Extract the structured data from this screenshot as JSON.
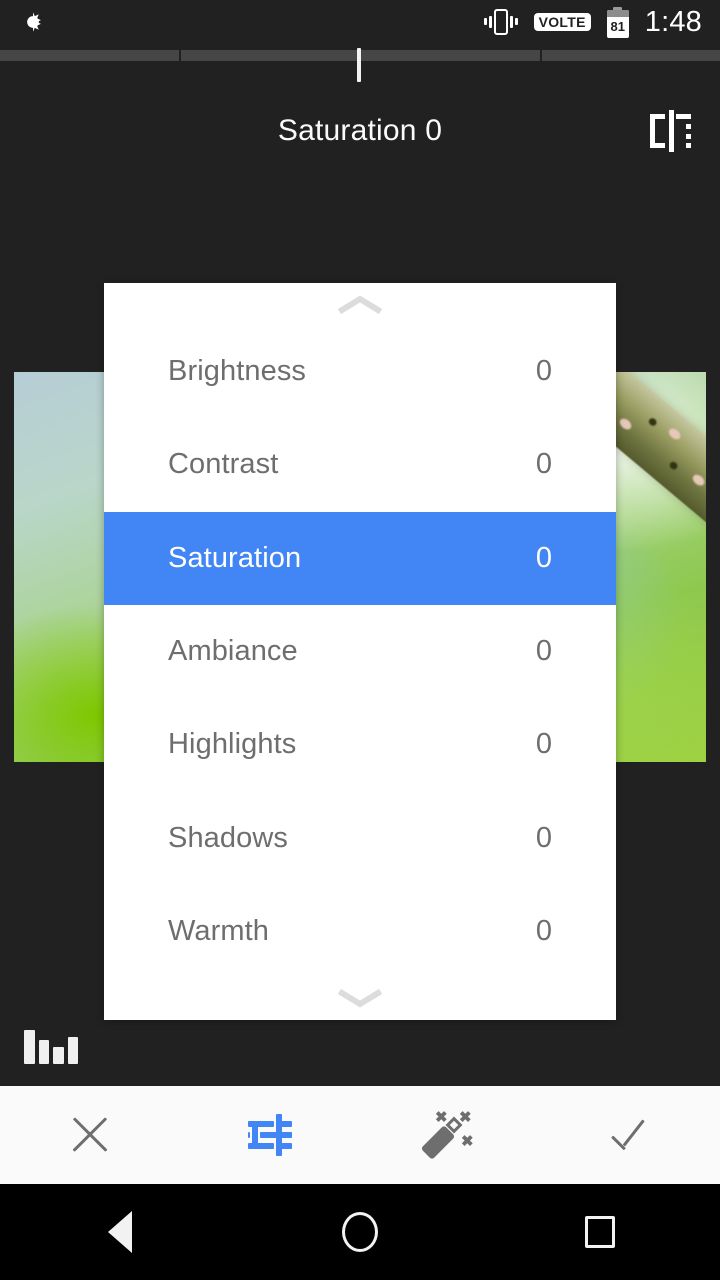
{
  "status_bar": {
    "auto_brightness_icon": "auto-brightness-icon",
    "vibrate_icon": "vibrate-icon",
    "volte_label": "VOLTE",
    "battery_level": "81",
    "time": "1:48"
  },
  "top_slider": {
    "segment_count": 4,
    "thumb_position_percent": 50
  },
  "header": {
    "title": "Saturation 0",
    "compare_icon": "compare-before-after-icon"
  },
  "adjust_panel": {
    "scroll_up_icon": "chevron-up-icon",
    "scroll_down_icon": "chevron-down-icon",
    "selected_index": 2,
    "highlight_color": "#4285f4",
    "items": [
      {
        "label": "Brightness",
        "value": "0"
      },
      {
        "label": "Contrast",
        "value": "0"
      },
      {
        "label": "Saturation",
        "value": "0"
      },
      {
        "label": "Ambiance",
        "value": "0"
      },
      {
        "label": "Highlights",
        "value": "0"
      },
      {
        "label": "Shadows",
        "value": "0"
      },
      {
        "label": "Warmth",
        "value": "0"
      }
    ]
  },
  "canvas": {
    "histogram_icon": "histogram-icon"
  },
  "toolbar": {
    "items": [
      {
        "name": "cancel-button",
        "icon": "close-icon",
        "label": "Cancel",
        "active": false
      },
      {
        "name": "adjust-tool-button",
        "icon": "tune-icon",
        "label": "Adjust",
        "active": true
      },
      {
        "name": "auto-enhance-button",
        "icon": "magic-wand-icon",
        "label": "Auto Enhance",
        "active": false
      },
      {
        "name": "apply-button",
        "icon": "check-icon",
        "label": "Apply",
        "active": false
      }
    ],
    "active_color": "#4285f4",
    "inactive_color": "#6e6e6e"
  },
  "nav_bar": {
    "back_label": "Back",
    "home_label": "Home",
    "recents_label": "Recents"
  }
}
